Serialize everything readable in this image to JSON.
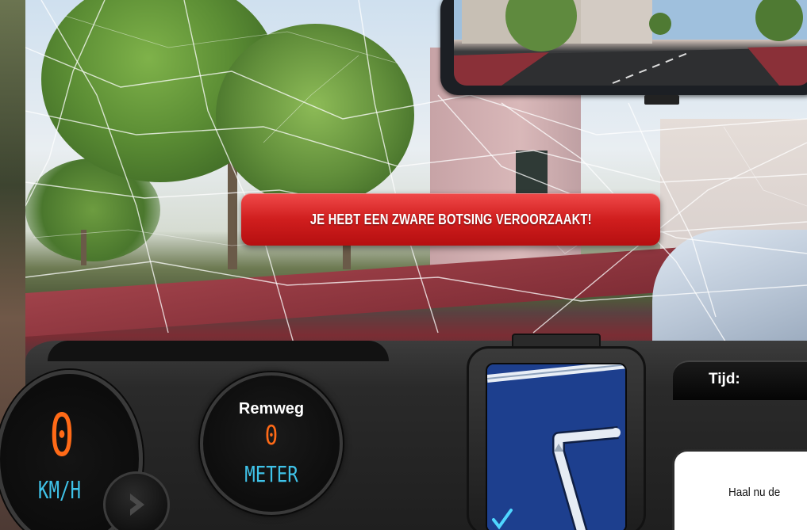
{
  "alert": {
    "message": "JE HEBT EEN ZWARE BOTSING VEROORZAAKT!"
  },
  "speedometer": {
    "value": "0",
    "unit": "KM/H"
  },
  "remweg": {
    "label": "Remweg",
    "value": "0",
    "unit": "METER"
  },
  "time_panel": {
    "label": "Tijd:"
  },
  "info_panel": {
    "text": "Haal nu de"
  },
  "icons": {
    "continue": "chevron-right-icon",
    "gps_check": "checkmark-icon"
  },
  "colors": {
    "alert_red": "#d01e1e",
    "speed_orange": "#ff6a17",
    "unit_cyan": "#3fc3e9",
    "gps_blue": "#1d3f8e"
  }
}
